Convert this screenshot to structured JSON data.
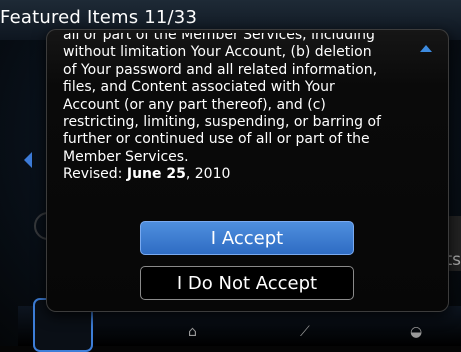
{
  "background": {
    "title": "Featured Items 11/33",
    "partial_right_text": "ts"
  },
  "dialog": {
    "lines": [
      "all or part of the Member Services, including",
      "without limitation Your Account, (b) deletion",
      "of Your password and all related information,",
      "files, and Content associated with Your",
      "Account (or any part thereof), and (c)",
      "restricting, limiting, suspending, or barring of",
      "further or continued use of all or part of the",
      "Member Services."
    ],
    "revised_label": "Revised: ",
    "revised_date_bold": "June 25",
    "revised_year": ", 2010",
    "accept_label": "I Accept",
    "decline_label": "I Do Not Accept"
  },
  "colors": {
    "accent": "#3d7ed8",
    "button_blue": "#2f6cc3"
  }
}
